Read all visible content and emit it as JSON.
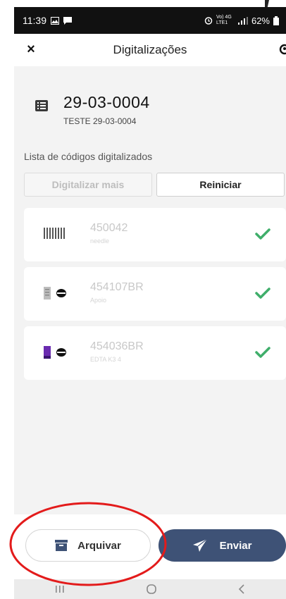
{
  "status_bar": {
    "time": "11:39",
    "network": "Vo) 4G LTE1",
    "battery": "62%"
  },
  "header": {
    "title": "Digitalizações",
    "close_label": "×"
  },
  "document": {
    "title": "29-03-0004",
    "subtitle": "TESTE 29-03-0004"
  },
  "list_label": "Lista de códigos digitalizados",
  "actions": {
    "scan_more": "Digitalizar mais",
    "restart": "Reiniciar"
  },
  "items": [
    {
      "code": "450042",
      "description": "needle",
      "icon": "barcode-icon",
      "status": "scanned"
    },
    {
      "code": "454107BR",
      "description": "Apoio",
      "icon": "tube-icon",
      "tube_color": "#bdbdbd",
      "status": "scanned"
    },
    {
      "code": "454036BR",
      "description": "EDTA K3 4",
      "icon": "tube-icon",
      "tube_color": "#6a2bb0",
      "status": "scanned"
    }
  ],
  "bottom": {
    "archive_label": "Arquivar",
    "send_label": "Enviar"
  },
  "colors": {
    "accent": "#3e5276",
    "check": "#3fae6a",
    "annotation": "#e31b1b"
  }
}
